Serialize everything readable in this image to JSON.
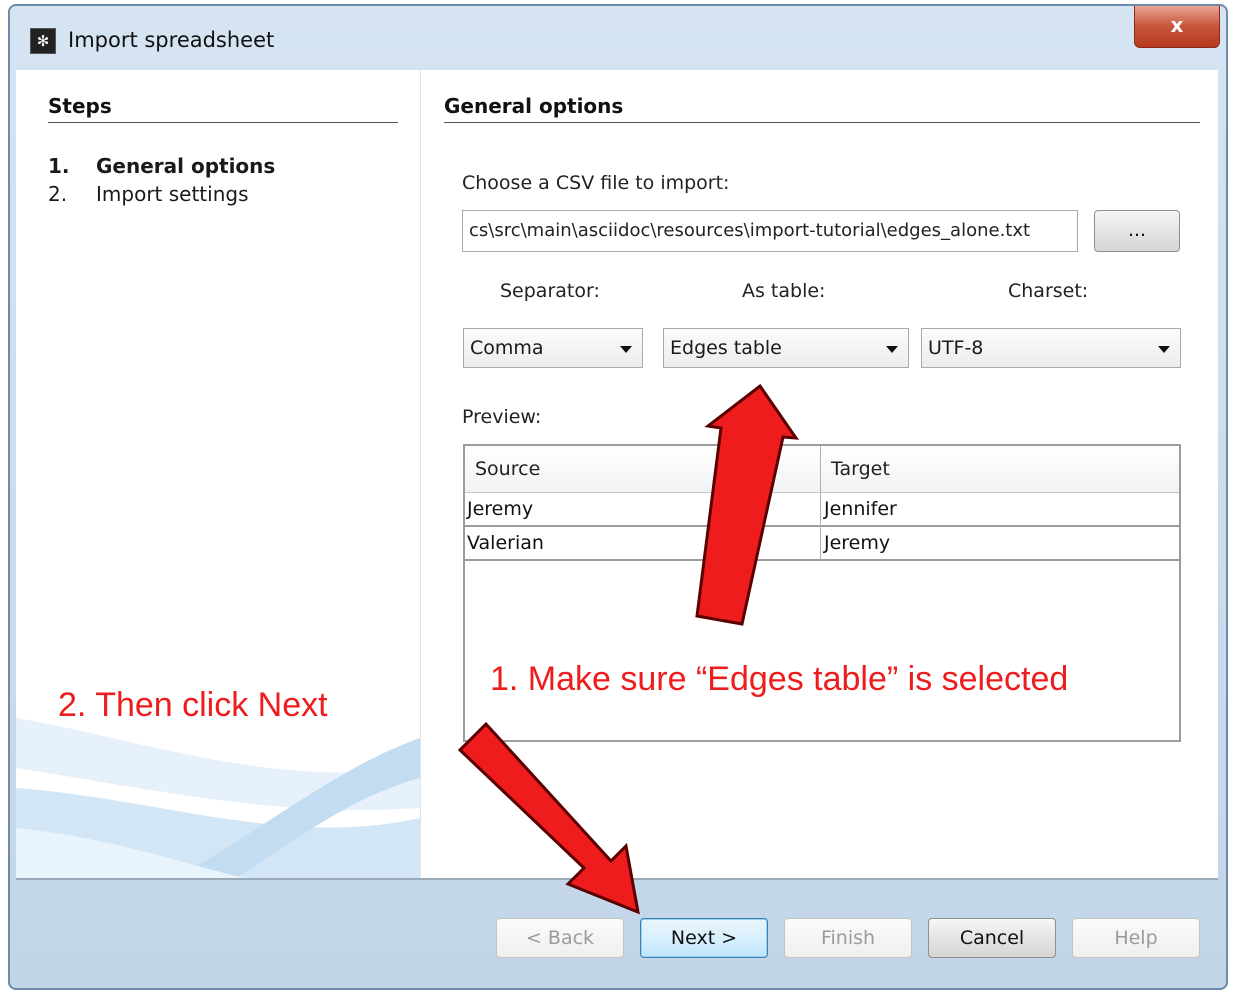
{
  "window": {
    "title": "Import spreadsheet",
    "close_label": "x"
  },
  "steps": {
    "heading": "Steps",
    "items": [
      {
        "num": "1.",
        "label": "General options",
        "active": true
      },
      {
        "num": "2.",
        "label": "Import settings",
        "active": false
      }
    ]
  },
  "general": {
    "heading": "General options",
    "file_label": "Choose a CSV file to import:",
    "file_path": "cs\\src\\main\\asciidoc\\resources\\import-tutorial\\edges_alone.txt",
    "browse_label": "...",
    "separator_label": "Separator:",
    "separator_value": "Comma",
    "astable_label": "As table:",
    "astable_value": "Edges table",
    "charset_label": "Charset:",
    "charset_value": "UTF-8",
    "preview_label": "Preview:",
    "preview": {
      "columns": [
        "Source",
        "Target"
      ],
      "rows": [
        [
          "Jeremy",
          "Jennifer"
        ],
        [
          "Valerian",
          "Jeremy"
        ]
      ]
    }
  },
  "annotations": {
    "step1": "1. Make sure “Edges table” is selected",
    "step2": "2. Then click Next",
    "arrow_color": "#ee1c1c"
  },
  "footer": {
    "back_label": "< Back",
    "next_label": "Next >",
    "finish_label": "Finish",
    "cancel_label": "Cancel",
    "help_label": "Help"
  }
}
